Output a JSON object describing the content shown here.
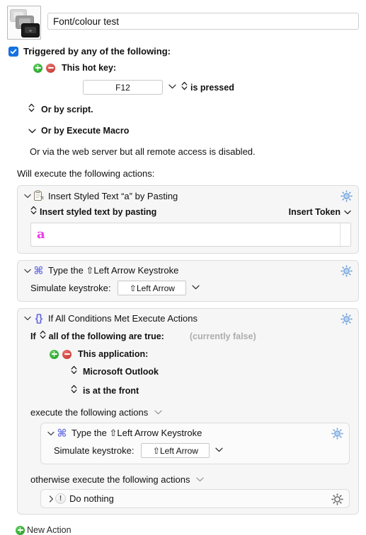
{
  "macro": {
    "icon_name": "stacked-screens-icon",
    "title_value": "Font/colour test",
    "title_placeholder": "Macro Name"
  },
  "trigger": {
    "checkbox_checked": true,
    "label": "Triggered by any of the following:",
    "hotkey_label": "This hot key:",
    "hotkey_value": "F12",
    "hotkey_condition": "is pressed",
    "or_script": "Or by script.",
    "or_execute_macro": "Or by Execute Macro",
    "web_server_note": "Or via the web server but all remote access is disabled.",
    "add_button": "+",
    "remove_button": "−"
  },
  "will_execute_label": "Will execute the following actions:",
  "actions": [
    {
      "icon": "clipboard-icon",
      "title": "Insert Styled Text “a” by Pasting",
      "gear": "gear-icon-blue",
      "mode_label": "Insert styled text by pasting",
      "insert_token_label": "Insert Token",
      "styled_text": "a",
      "styled_text_color": "#ee3ce8"
    },
    {
      "icon": "command-key-icon",
      "title": "Type the ⇧Left Arrow Keystroke",
      "gear": "gear-icon-blue",
      "keystroke_label": "Simulate keystroke:",
      "keystroke_value": "⇧Left Arrow"
    },
    {
      "icon": "braces-icon",
      "title": "If All Conditions Met Execute Actions",
      "gear": "gear-icon-blue",
      "if_prefix": "If",
      "if_quantifier": "all of the following are true:",
      "currently": "(currently false)",
      "condition_label": "This application:",
      "condition_app": "Microsoft Outlook",
      "condition_state": "is at the front",
      "then_label": "execute the following actions",
      "else_label": "otherwise execute the following actions",
      "then_action": {
        "icon": "command-key-icon",
        "title": "Type the ⇧Left Arrow Keystroke",
        "gear": "gear-icon-blue",
        "keystroke_label": "Simulate keystroke:",
        "keystroke_value": "⇧Left Arrow"
      },
      "else_action": {
        "icon": "exclamation-icon",
        "title": "Do nothing",
        "gear": "gear-icon-gray",
        "disclosure": "›"
      }
    }
  ],
  "new_action": {
    "label": "New Action",
    "icon": "plus-circle-green-icon"
  },
  "colors": {
    "accent_blue": "#1473e6",
    "action_icon_blue": "#6c72e0",
    "gear_blue": "#9ec2ef",
    "styled_text_magenta": "#ee3ce8",
    "add_green": "#199a19",
    "remove_red": "#c22f28",
    "muted_gray": "#adadad"
  }
}
